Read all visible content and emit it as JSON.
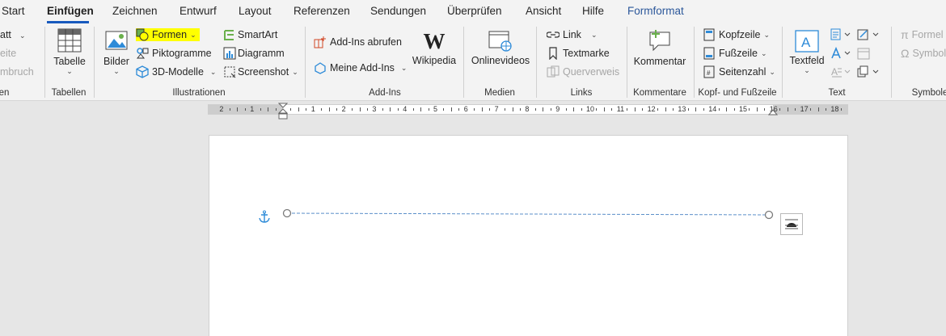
{
  "tabs": [
    {
      "label": "Start"
    },
    {
      "label": "Einfügen"
    },
    {
      "label": "Zeichnen"
    },
    {
      "label": "Entwurf"
    },
    {
      "label": "Layout"
    },
    {
      "label": "Referenzen"
    },
    {
      "label": "Sendungen"
    },
    {
      "label": "Überprüfen"
    },
    {
      "label": "Ansicht"
    },
    {
      "label": "Hilfe"
    },
    {
      "label": "Formformat"
    }
  ],
  "active_tab": "Einfügen",
  "ribbon": {
    "partial_left": {
      "items": [
        "att",
        "eite",
        "mbruch"
      ],
      "group": "en"
    },
    "tabellen": {
      "button": "Tabelle",
      "group": "Tabellen"
    },
    "illustrationen": {
      "bilder": "Bilder",
      "formen": "Formen",
      "piktogramme": "Piktogramme",
      "modelle": "3D-Modelle",
      "smartart": "SmartArt",
      "diagramm": "Diagramm",
      "screenshot": "Screenshot",
      "group": "Illustrationen"
    },
    "addins": {
      "abrufen": "Add-Ins abrufen",
      "meine": "Meine Add-Ins",
      "wikipedia": "Wikipedia",
      "group": "Add-Ins"
    },
    "medien": {
      "onlinevideos": "Onlinevideos",
      "group": "Medien"
    },
    "links": {
      "link": "Link",
      "textmarke": "Textmarke",
      "querverweis": "Querverweis",
      "group": "Links"
    },
    "kommentare": {
      "kommentar": "Kommentar",
      "group": "Kommentare"
    },
    "kopf": {
      "kopfzeile": "Kopfzeile",
      "fusszeile": "Fußzeile",
      "seitenzahl": "Seitenzahl",
      "group": "Kopf- und Fußzeile"
    },
    "text": {
      "textfeld": "Textfeld",
      "group": "Text"
    },
    "symbole": {
      "formel": "Formel",
      "symbol": "Symbol",
      "group": "Symbole"
    }
  },
  "ruler": {
    "labels": [
      "2",
      "1",
      "1",
      "2",
      "3",
      "4",
      "5",
      "6",
      "7",
      "8",
      "9",
      "10",
      "11",
      "12",
      "13",
      "14",
      "15",
      "16",
      "17",
      "18"
    ]
  },
  "colors": {
    "accent": "#185abd",
    "highlight": "#ffff00",
    "context_tab": "#2b579a",
    "line": "#5b8fc9"
  }
}
